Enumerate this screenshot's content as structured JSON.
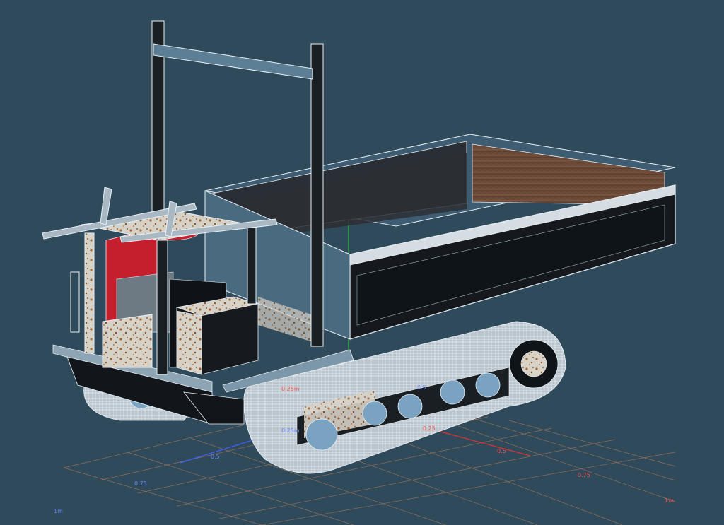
{
  "viewport": {
    "background_color": "#2f4a5b",
    "wire_color": "#e8f0f6",
    "grid_color": "#a0745a",
    "axis_colors": {
      "x": "#e03030",
      "y": "#30c040",
      "z": "#4060ff"
    }
  },
  "grid_labels": {
    "z_1": "0.25m",
    "z_2": "0.5",
    "z_3": "0.75",
    "z_4": "1m",
    "x_1": "0.25",
    "x_2": "0.5",
    "x_3": "0.75",
    "x_4": "1m",
    "y_1": "0.25m",
    "y_2": "0.5"
  }
}
